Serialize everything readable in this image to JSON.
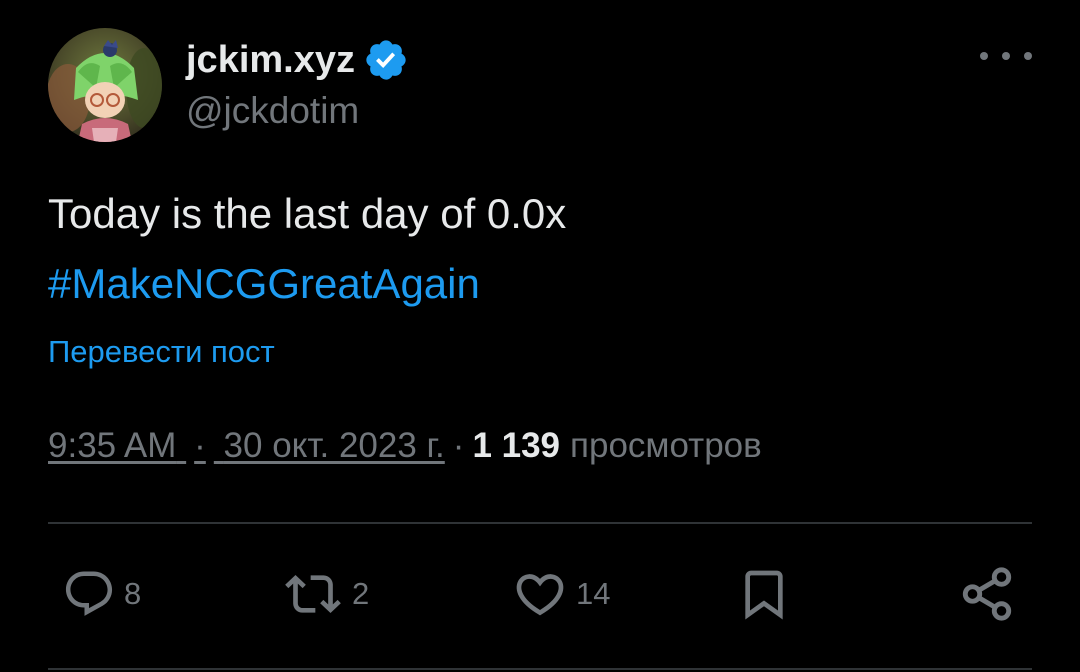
{
  "user": {
    "display_name": "jckim.xyz",
    "handle": "@jckdotim",
    "verified": true
  },
  "tweet": {
    "text": "Today is the last day of 0.0x",
    "hashtag": "#MakeNCGGreatAgain",
    "translate_label": "Перевести пост",
    "time": "9:35 AM",
    "date": "30 окт. 2023 г.",
    "separator": "·",
    "views_count": "1 139",
    "views_label": "просмотров"
  },
  "actions": {
    "replies": "8",
    "reposts": "2",
    "likes": "14"
  },
  "colors": {
    "background": "#000000",
    "text": "#e7e9ea",
    "secondary": "#71767b",
    "accent": "#1d9bf0"
  },
  "icons": [
    "more-icon",
    "verified-badge-icon",
    "reply-icon",
    "repost-icon",
    "like-icon",
    "bookmark-icon",
    "share-icon"
  ]
}
